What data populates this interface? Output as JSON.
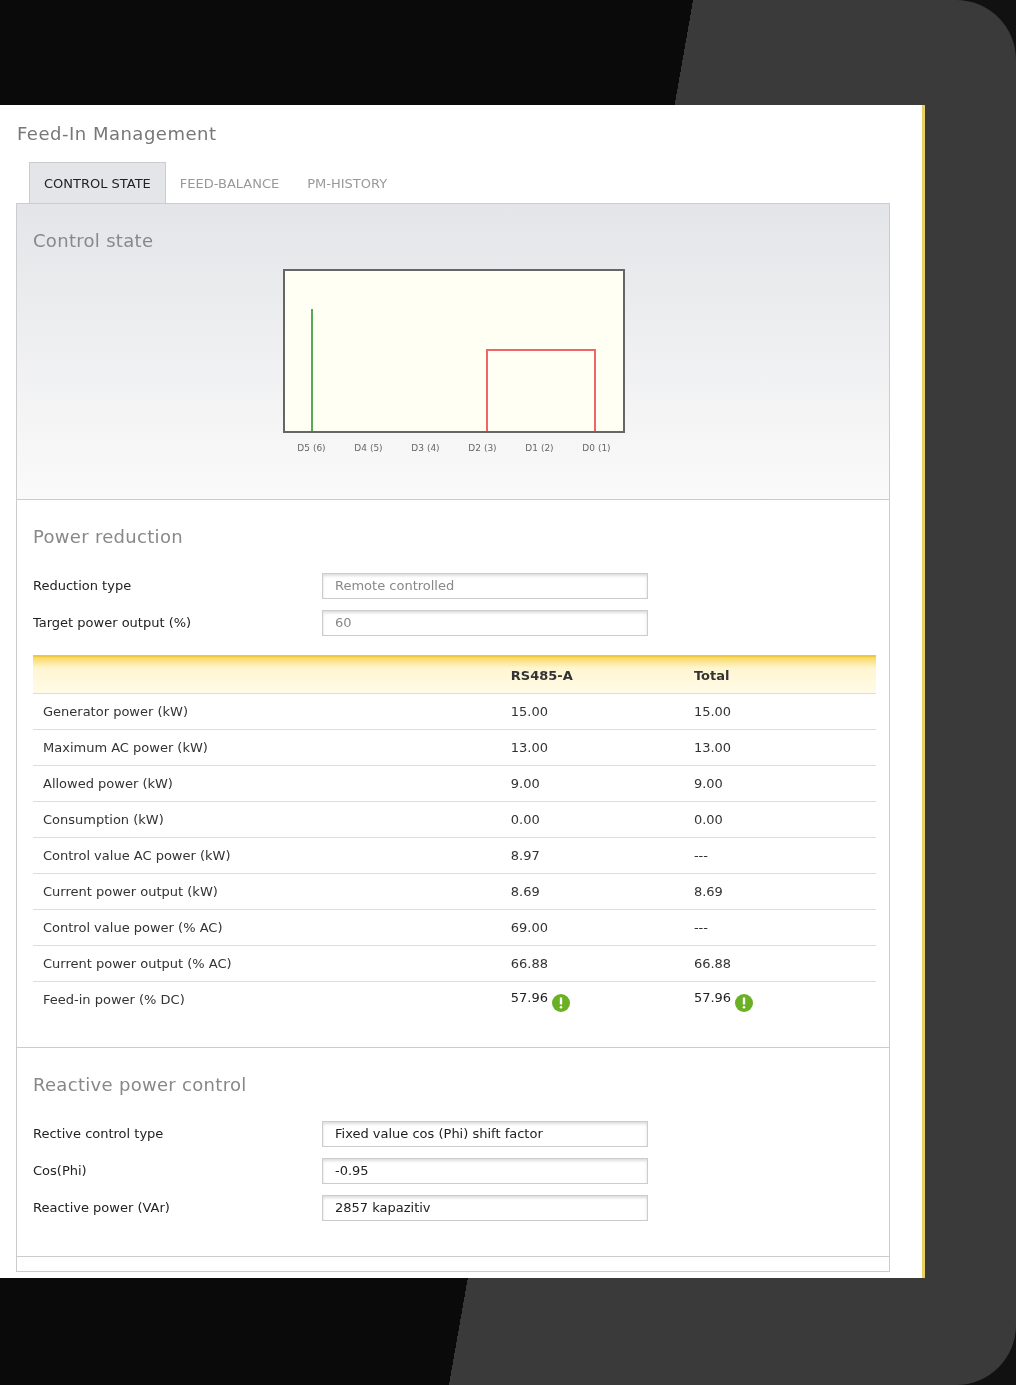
{
  "title": "Feed-In Management",
  "tabs": [
    {
      "label": "CONTROL STATE",
      "selected": true
    },
    {
      "label": "FEED-BALANCE",
      "selected": false
    },
    {
      "label": "PM-HISTORY",
      "selected": false
    }
  ],
  "control_state": {
    "heading": "Control state",
    "chart_labels": [
      "D5 (6)",
      "D4 (5)",
      "D3 (4)",
      "D2 (3)",
      "D1 (2)",
      "D0 (1)"
    ]
  },
  "power_reduction": {
    "heading": "Power reduction",
    "fields": [
      {
        "label": "Reduction type",
        "value": "Remote controlled",
        "disabled": true
      },
      {
        "label": "Target power output (%)",
        "value": "60",
        "disabled": true
      }
    ],
    "table": {
      "columns": [
        "RS485-A",
        "Total"
      ],
      "rows": [
        {
          "label": "Generator power (kW)",
          "cells": [
            {
              "text": "15.00",
              "alert": false
            },
            {
              "text": "15.00",
              "alert": false
            }
          ]
        },
        {
          "label": "Maximum AC power (kW)",
          "cells": [
            {
              "text": "13.00",
              "alert": false
            },
            {
              "text": "13.00",
              "alert": false
            }
          ]
        },
        {
          "label": "Allowed power (kW)",
          "cells": [
            {
              "text": "9.00",
              "alert": false
            },
            {
              "text": "9.00",
              "alert": false
            }
          ]
        },
        {
          "label": "Consumption (kW)",
          "cells": [
            {
              "text": "0.00",
              "alert": false
            },
            {
              "text": "0.00",
              "alert": false
            }
          ]
        },
        {
          "label": "Control value AC power (kW)",
          "cells": [
            {
              "text": "8.97",
              "alert": false
            },
            {
              "text": "---",
              "alert": false
            }
          ]
        },
        {
          "label": "Current power output (kW)",
          "cells": [
            {
              "text": "8.69",
              "alert": false
            },
            {
              "text": "8.69",
              "alert": false
            }
          ]
        },
        {
          "label": "Control value power (% AC)",
          "cells": [
            {
              "text": "69.00",
              "alert": false
            },
            {
              "text": "---",
              "alert": false
            }
          ]
        },
        {
          "label": "Current power output (% AC)",
          "cells": [
            {
              "text": "66.88",
              "alert": false
            },
            {
              "text": "66.88",
              "alert": false
            }
          ]
        },
        {
          "label": "Feed-in power (% DC)",
          "cells": [
            {
              "text": "57.96",
              "alert": true
            },
            {
              "text": "57.96",
              "alert": true
            }
          ]
        }
      ]
    }
  },
  "reactive_power_control": {
    "heading": "Reactive power control",
    "fields": [
      {
        "label": "Rective control type",
        "value": "Fixed value cos (Phi) shift factor",
        "disabled": false
      },
      {
        "label": "Cos(Phi)",
        "value": "-0.95",
        "disabled": false
      },
      {
        "label": "Reactive power (VAr)",
        "value": "2857 kapazitiv",
        "disabled": false
      }
    ]
  }
}
